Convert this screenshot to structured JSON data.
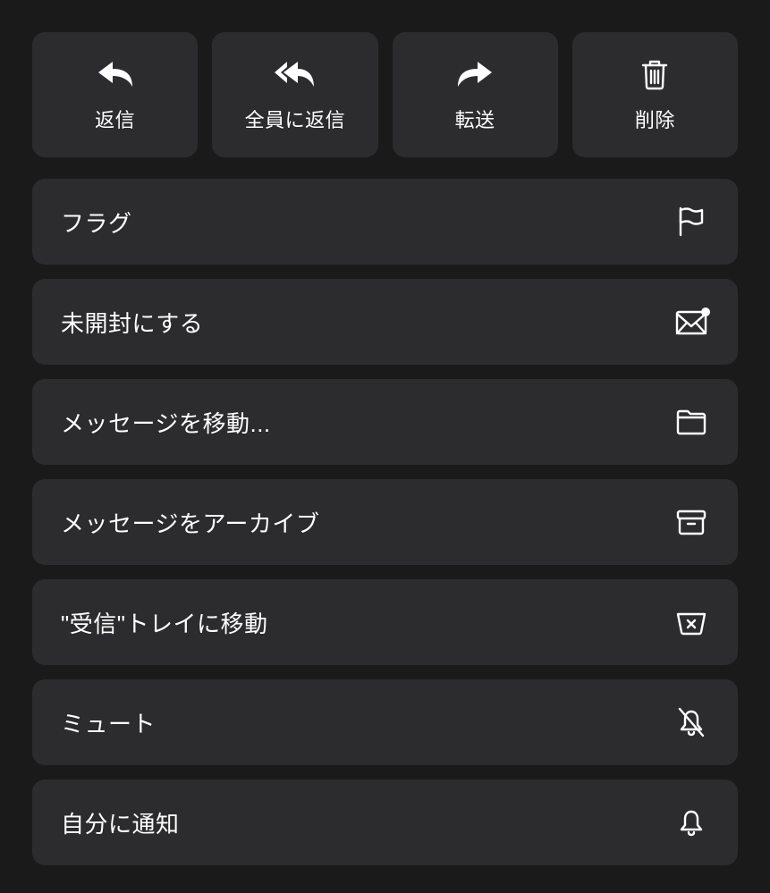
{
  "top": {
    "reply": {
      "label": "返信"
    },
    "replyAll": {
      "label": "全員に返信"
    },
    "forward": {
      "label": "転送"
    },
    "delete": {
      "label": "削除"
    }
  },
  "rows": {
    "flag": {
      "label": "フラグ"
    },
    "markUnread": {
      "label": "未開封にする"
    },
    "moveMessage": {
      "label": "メッセージを移動..."
    },
    "archive": {
      "label": "メッセージをアーカイブ"
    },
    "moveInbox": {
      "label": "\"受信\"トレイに移動"
    },
    "mute": {
      "label": "ミュート"
    },
    "notifyMe": {
      "label": "自分に通知"
    }
  }
}
